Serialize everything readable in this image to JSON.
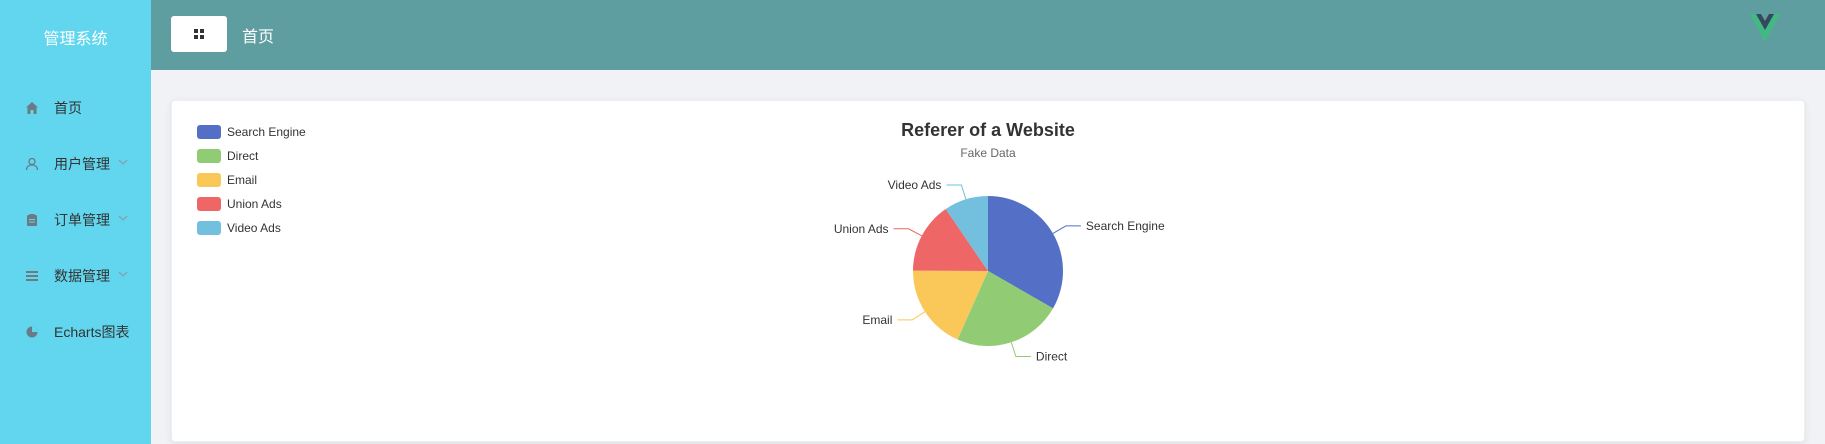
{
  "sidebar": {
    "title": "管理系统",
    "items": [
      {
        "label": "首页",
        "icon": "home-icon",
        "has_children": false
      },
      {
        "label": "用户管理",
        "icon": "user-icon",
        "has_children": true
      },
      {
        "label": "订单管理",
        "icon": "clipboard-icon",
        "has_children": true
      },
      {
        "label": "数据管理",
        "icon": "list-icon",
        "has_children": true
      },
      {
        "label": "Echarts图表",
        "icon": "pie-chart-icon",
        "has_children": false
      }
    ]
  },
  "header": {
    "title": "首页",
    "toggle_icon": "grid-menu-icon",
    "logo": "vue-logo",
    "background": "#5f9ea0"
  },
  "colors": {
    "sidebar_bg": "#61d6ee",
    "header_bg": "#5f9ea0"
  },
  "chart_data": {
    "type": "pie",
    "title": "Referer of a Website",
    "subtitle": "Fake Data",
    "legend_position": "top-left",
    "series": [
      {
        "name": "Search Engine",
        "value": 1048,
        "color": "#5470c6"
      },
      {
        "name": "Direct",
        "value": 735,
        "color": "#91cc75"
      },
      {
        "name": "Email",
        "value": 580,
        "color": "#fac858"
      },
      {
        "name": "Union Ads",
        "value": 484,
        "color": "#ee6666"
      },
      {
        "name": "Video Ads",
        "value": 300,
        "color": "#73c0de"
      }
    ]
  }
}
